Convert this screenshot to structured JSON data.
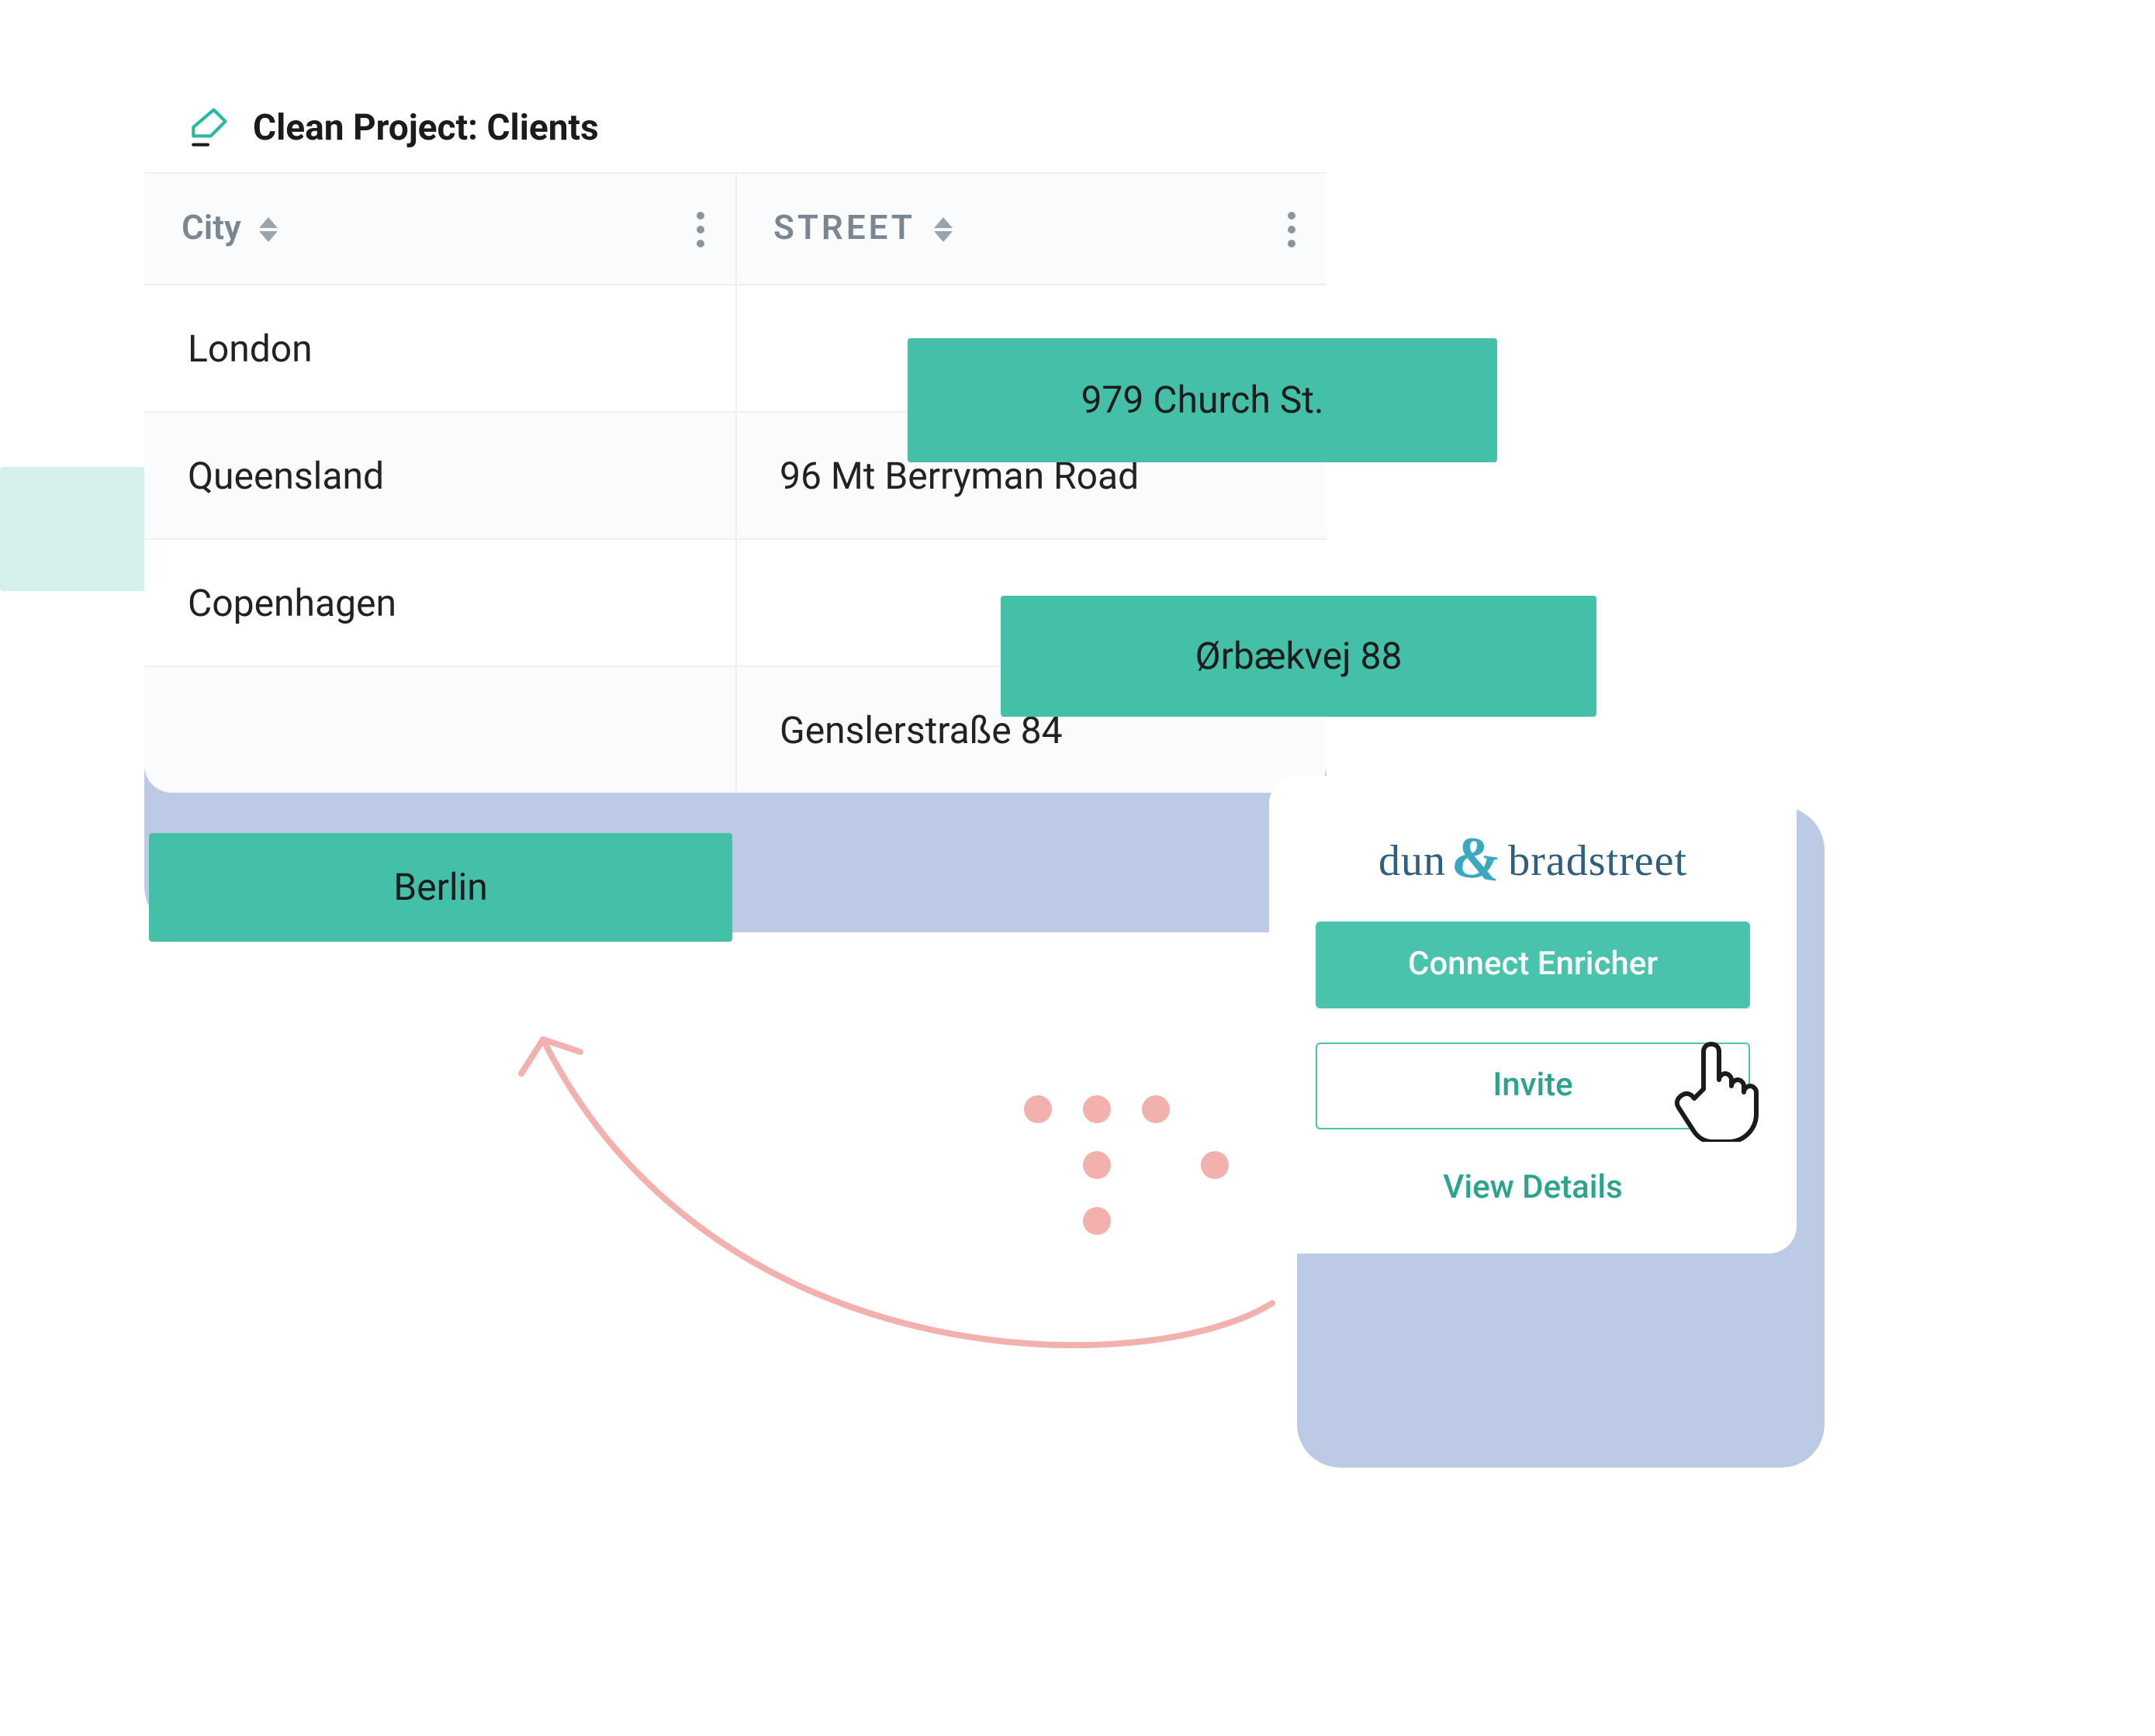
{
  "table": {
    "title": "Clean Project: Clients",
    "columns": {
      "city": "City",
      "street": "STREET"
    },
    "rows": [
      {
        "city": "London",
        "street": "979 Church St."
      },
      {
        "city": "Queensland",
        "street": "96 Mt Berryman Road"
      },
      {
        "city": "Copenhagen",
        "street": "Ørbækvej 88"
      },
      {
        "city": "",
        "street": "Genslerstraße 84"
      }
    ]
  },
  "highlights": {
    "berlin": "Berlin",
    "church": "979 Church St.",
    "orbak": "Ørbækvej 88"
  },
  "enricher": {
    "vendor_first": "dun",
    "vendor_last": "bradstreet",
    "connect": "Connect Enricher",
    "invite": "Invite",
    "details": "View Details"
  }
}
